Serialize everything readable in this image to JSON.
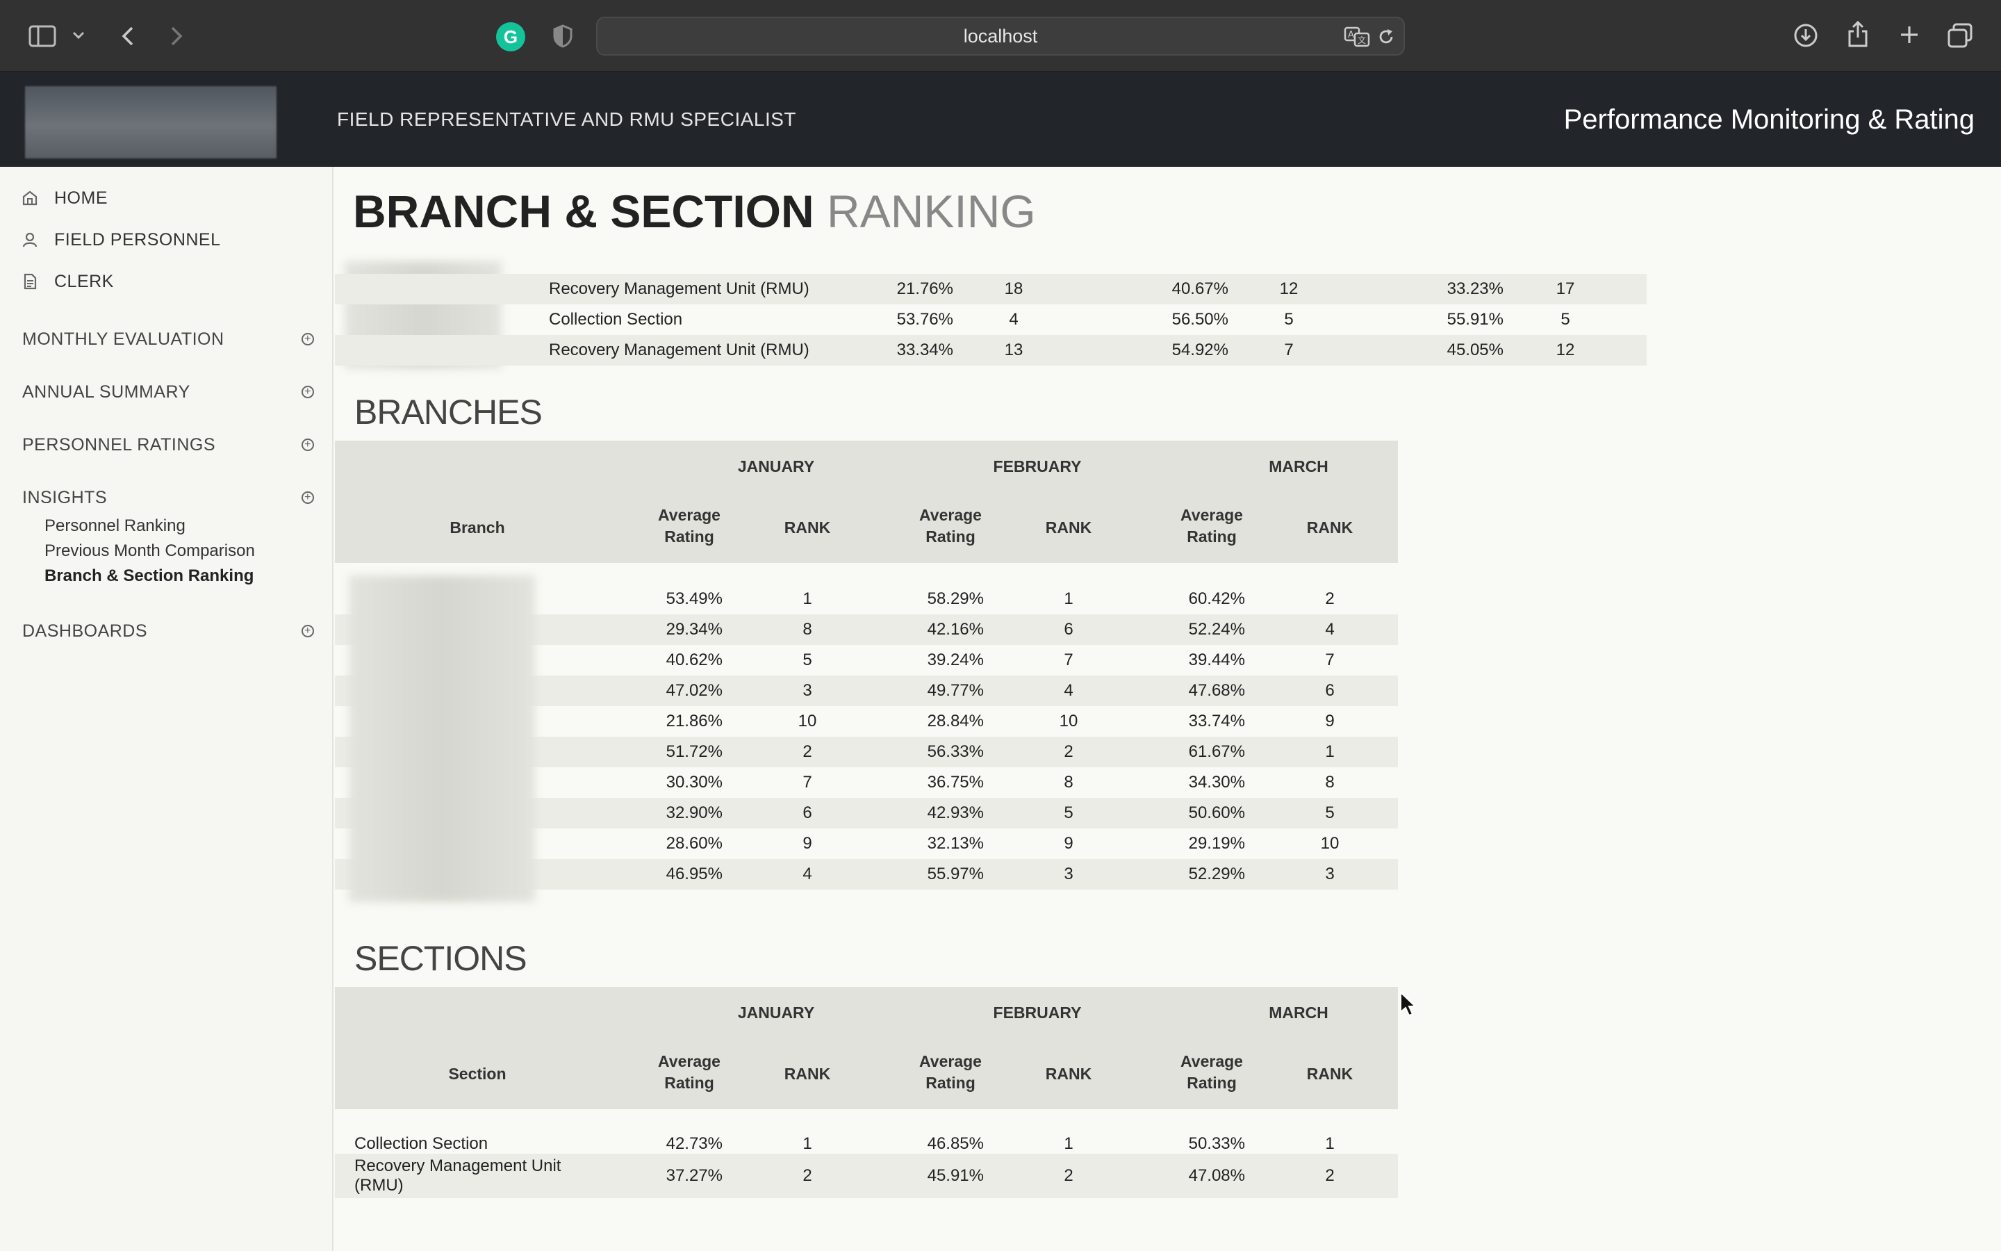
{
  "browser": {
    "url": "localhost",
    "icons": [
      "sidebar-toggle-icon",
      "chevron-down-icon",
      "back-icon",
      "forward-icon",
      "grammarly-icon",
      "shield-icon",
      "translate-icon",
      "reload-icon",
      "download-icon",
      "share-icon",
      "new-tab-icon",
      "tab-overview-icon"
    ],
    "grammarly_letter": "G"
  },
  "header": {
    "role": "FIELD REPRESENTATIVE AND RMU SPECIALIST",
    "app_title": "Performance Monitoring & Rating"
  },
  "sidebar": {
    "top_items": [
      {
        "label": "HOME",
        "icon": "home-icon"
      },
      {
        "label": "FIELD PERSONNEL",
        "icon": "person-icon"
      },
      {
        "label": "CLERK",
        "icon": "document-icon"
      }
    ],
    "groups": [
      {
        "label": "MONTHLY EVALUATION"
      },
      {
        "label": "ANNUAL SUMMARY"
      },
      {
        "label": "PERSONNEL RATINGS"
      },
      {
        "label": "INSIGHTS"
      },
      {
        "label": "DASHBOARDS"
      }
    ],
    "insights_items": [
      {
        "label": "Personnel Ranking"
      },
      {
        "label": "Previous Month Comparison"
      },
      {
        "label": "Branch & Section Ranking",
        "active": true
      }
    ],
    "expand_symbol": "+"
  },
  "page": {
    "title_bold": "BRANCH & SECTION",
    "title_light": "RANKING"
  },
  "top_table": {
    "rows": [
      {
        "section": "Recovery Management Unit (RMU)",
        "jan_avg": "21.76%",
        "jan_rank": "18",
        "feb_avg": "40.67%",
        "feb_rank": "12",
        "mar_avg": "33.23%",
        "mar_rank": "17"
      },
      {
        "section": "Collection Section",
        "jan_avg": "53.76%",
        "jan_rank": "4",
        "feb_avg": "56.50%",
        "feb_rank": "5",
        "mar_avg": "55.91%",
        "mar_rank": "5"
      },
      {
        "section": "Recovery Management Unit (RMU)",
        "jan_avg": "33.34%",
        "jan_rank": "13",
        "feb_avg": "54.92%",
        "feb_rank": "7",
        "mar_avg": "45.05%",
        "mar_rank": "12"
      }
    ]
  },
  "branches": {
    "title": "BRANCHES",
    "months": [
      "JANUARY",
      "FEBRUARY",
      "MARCH"
    ],
    "col_label": "Branch",
    "avg_label_1": "Average",
    "avg_label_2": "Rating",
    "rank_label": "RANK",
    "rows": [
      {
        "jan_avg": "53.49%",
        "jan_rank": "1",
        "feb_avg": "58.29%",
        "feb_rank": "1",
        "mar_avg": "60.42%",
        "mar_rank": "2"
      },
      {
        "jan_avg": "29.34%",
        "jan_rank": "8",
        "feb_avg": "42.16%",
        "feb_rank": "6",
        "mar_avg": "52.24%",
        "mar_rank": "4"
      },
      {
        "jan_avg": "40.62%",
        "jan_rank": "5",
        "feb_avg": "39.24%",
        "feb_rank": "7",
        "mar_avg": "39.44%",
        "mar_rank": "7"
      },
      {
        "jan_avg": "47.02%",
        "jan_rank": "3",
        "feb_avg": "49.77%",
        "feb_rank": "4",
        "mar_avg": "47.68%",
        "mar_rank": "6"
      },
      {
        "jan_avg": "21.86%",
        "jan_rank": "10",
        "feb_avg": "28.84%",
        "feb_rank": "10",
        "mar_avg": "33.74%",
        "mar_rank": "9"
      },
      {
        "jan_avg": "51.72%",
        "jan_rank": "2",
        "feb_avg": "56.33%",
        "feb_rank": "2",
        "mar_avg": "61.67%",
        "mar_rank": "1"
      },
      {
        "jan_avg": "30.30%",
        "jan_rank": "7",
        "feb_avg": "36.75%",
        "feb_rank": "8",
        "mar_avg": "34.30%",
        "mar_rank": "8"
      },
      {
        "jan_avg": "32.90%",
        "jan_rank": "6",
        "feb_avg": "42.93%",
        "feb_rank": "5",
        "mar_avg": "50.60%",
        "mar_rank": "5"
      },
      {
        "jan_avg": "28.60%",
        "jan_rank": "9",
        "feb_avg": "32.13%",
        "feb_rank": "9",
        "mar_avg": "29.19%",
        "mar_rank": "10"
      },
      {
        "jan_avg": "46.95%",
        "jan_rank": "4",
        "feb_avg": "55.97%",
        "feb_rank": "3",
        "mar_avg": "52.29%",
        "mar_rank": "3"
      }
    ]
  },
  "sections": {
    "title": "SECTIONS",
    "months": [
      "JANUARY",
      "FEBRUARY",
      "MARCH"
    ],
    "col_label": "Section",
    "avg_label_1": "Average",
    "avg_label_2": "Rating",
    "rank_label": "RANK",
    "rows": [
      {
        "section": "Collection Section",
        "jan_avg": "42.73%",
        "jan_rank": "1",
        "feb_avg": "46.85%",
        "feb_rank": "1",
        "mar_avg": "50.33%",
        "mar_rank": "1"
      },
      {
        "section": "Recovery Management Unit (RMU)",
        "jan_avg": "37.27%",
        "jan_rank": "2",
        "feb_avg": "45.91%",
        "feb_rank": "2",
        "mar_avg": "47.08%",
        "mar_rank": "2"
      }
    ]
  }
}
